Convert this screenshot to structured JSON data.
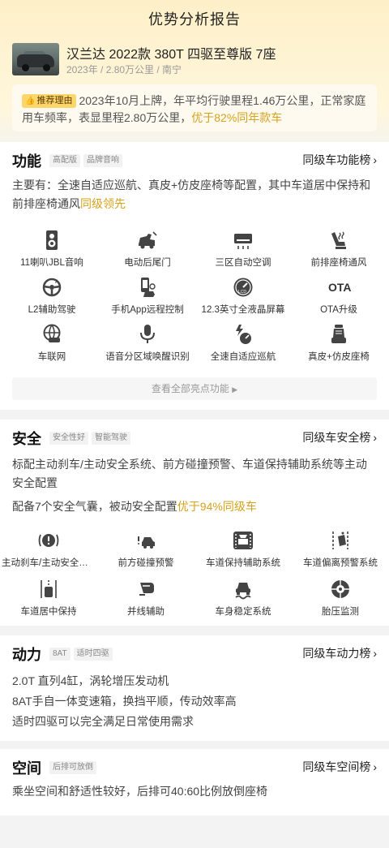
{
  "page": {
    "title": "优势分析报告"
  },
  "car": {
    "name": "汉兰达 2022款 380T 四驱至尊版 7座",
    "meta": "2023年 / 2.80万公里 / 南宁"
  },
  "reason": {
    "tag": "推荐理由",
    "text": "2023年10月上牌，年平均行驶里程1.46万公里，正常家庭用车频率，表显里程2.80万公里，",
    "highlight": "优于82%同年款车"
  },
  "sections": {
    "function": {
      "title": "功能",
      "tags": [
        "高配版",
        "品牌音响"
      ],
      "rank_link": "同级车功能榜",
      "desc": "主要有：全速自适应巡航、真皮+仿皮座椅等配置，其中车道居中保持和前排座椅通风",
      "desc_highlight": "同级领先",
      "features": [
        {
          "label": "11喇叭JBL音响",
          "icon": "speaker-icon"
        },
        {
          "label": "电动后尾门",
          "icon": "power-tailgate-icon"
        },
        {
          "label": "三区自动空调",
          "icon": "air-conditioner-icon"
        },
        {
          "label": "前排座椅通风",
          "icon": "seat-ventilation-icon"
        },
        {
          "label": "L2辅助驾驶",
          "icon": "steering-wheel-icon"
        },
        {
          "label": "手机App远程控制",
          "icon": "phone-remote-icon"
        },
        {
          "label": "12.3英寸全液晶屏幕",
          "icon": "lcd-gauge-icon"
        },
        {
          "label": "OTA升级",
          "icon": "ota-icon"
        },
        {
          "label": "车联网",
          "icon": "connected-car-icon"
        },
        {
          "label": "语音分区域唤醒识别",
          "icon": "microphone-icon"
        },
        {
          "label": "全速自适应巡航",
          "icon": "adaptive-cruise-icon"
        },
        {
          "label": "真皮+仿皮座椅",
          "icon": "leather-seat-icon"
        }
      ],
      "see_all": "查看全部亮点功能"
    },
    "safety": {
      "title": "安全",
      "tags": [
        "安全性好",
        "智能驾驶"
      ],
      "rank_link": "同级车安全榜",
      "desc1": "标配主动刹车/主动安全系统、前方碰撞预警、车道保持辅助系统等主动安全配置",
      "desc2": "配备7个安全气囊，被动安全配置",
      "desc2_highlight": "优于94%同级车",
      "features": [
        {
          "label": "主动刹车/主动安全系统",
          "icon": "brake-warning-icon"
        },
        {
          "label": "前方碰撞预警",
          "icon": "collision-warning-icon"
        },
        {
          "label": "车道保持辅助系统",
          "icon": "lane-keep-icon"
        },
        {
          "label": "车道偏离预警系统",
          "icon": "lane-departure-icon"
        },
        {
          "label": "车道居中保持",
          "icon": "lane-center-icon"
        },
        {
          "label": "并线辅助",
          "icon": "blind-spot-icon"
        },
        {
          "label": "车身稳定系统",
          "icon": "stability-control-icon"
        },
        {
          "label": "胎压监测",
          "icon": "tire-pressure-icon"
        }
      ]
    },
    "power": {
      "title": "动力",
      "tags": [
        "8AT",
        "适时四驱"
      ],
      "rank_link": "同级车动力榜",
      "lines": [
        "2.0T 直列4缸，涡轮增压发动机",
        "8AT手自一体变速箱，换挡平顺，传动效率高",
        "适时四驱可以完全满足日常使用需求"
      ]
    },
    "space": {
      "title": "空间",
      "tags": [
        "后排可放倒"
      ],
      "rank_link": "同级车空间榜",
      "lines": [
        "乘坐空间和舒适性较好，后排可40:60比例放倒座椅"
      ]
    }
  },
  "colors": {
    "accent": "#d6a21b",
    "tag_bg": "#fcd56b"
  }
}
